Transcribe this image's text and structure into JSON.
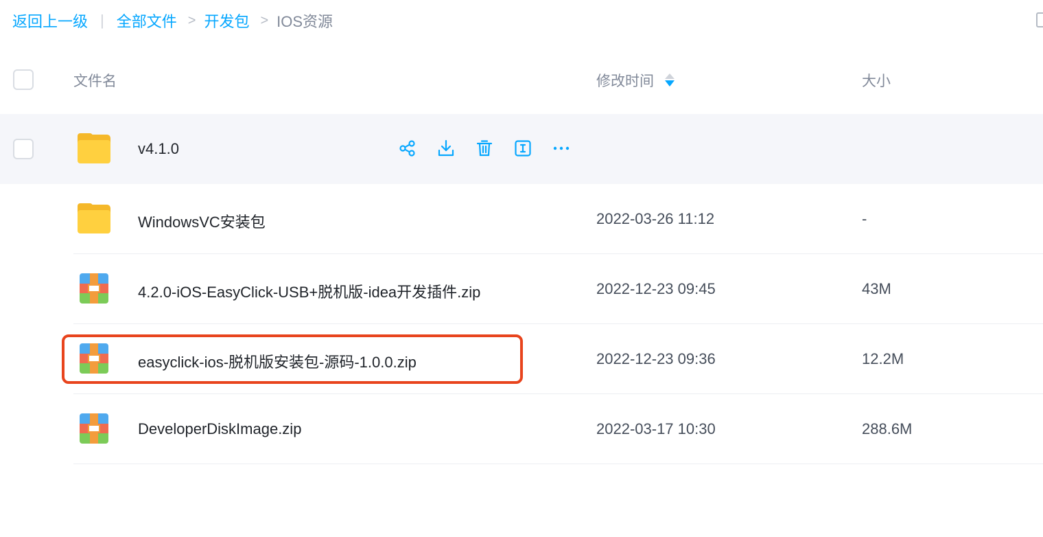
{
  "breadcrumb": {
    "back": "返回上一级",
    "all_files": "全部文件",
    "folder": "开发包",
    "current": "IOS资源"
  },
  "header": {
    "name": "文件名",
    "time": "修改时间",
    "size": "大小"
  },
  "rows": [
    {
      "name": "v4.1.0",
      "time": "",
      "size": "",
      "type": "folder"
    },
    {
      "name": "WindowsVC安装包",
      "time": "2022-03-26 11:12",
      "size": "-",
      "type": "folder"
    },
    {
      "name": "4.2.0-iOS-EasyClick-USB+脱机版-idea开发插件.zip",
      "time": "2022-12-23 09:45",
      "size": "43M",
      "type": "zip"
    },
    {
      "name": "easyclick-ios-脱机版安装包-源码-1.0.0.zip",
      "time": "2022-12-23 09:36",
      "size": "12.2M",
      "type": "zip"
    },
    {
      "name": "DeveloperDiskImage.zip",
      "time": "2022-03-17 10:30",
      "size": "288.6M",
      "type": "zip"
    }
  ],
  "colors": {
    "accent": "#06a7ff",
    "highlight": "#e8441d",
    "hover_row": "#f5f6fa"
  },
  "icons": [
    "share-icon",
    "download-icon",
    "delete-icon",
    "rename-icon",
    "more-icon",
    "folder-icon",
    "zip-icon",
    "sort-icon"
  ]
}
